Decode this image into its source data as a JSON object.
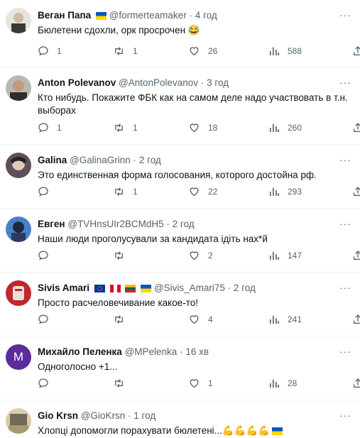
{
  "tweets": [
    {
      "name": "Веган Папа",
      "handle": "@formerteamaker",
      "time": "4 год",
      "text": "Бюлетени сдохли, орк просрочен 😂",
      "flags": [
        "ua"
      ],
      "stats": {
        "replies": "1",
        "retweets": "1",
        "likes": "26",
        "views": "588"
      },
      "avatar_color": "#d9d2c8"
    },
    {
      "name": "Anton Polevanov",
      "handle": "@AntonPolevanov",
      "time": "3 год",
      "text": "Кто нибудь. Покажите ФБК как на самом деле надо участвовать в т.н. выборах",
      "flags": [],
      "stats": {
        "replies": "1",
        "retweets": "1",
        "likes": "18",
        "views": "260"
      },
      "avatar_color": "#8e8f86"
    },
    {
      "name": "Galina",
      "handle": "@GalinaGrinn",
      "time": "2 год",
      "text": "Это единственная форма голосования, которого достойна рф.",
      "flags": [],
      "stats": {
        "replies": "",
        "retweets": "1",
        "likes": "22",
        "views": "293"
      },
      "avatar_color": "#6b5a63"
    },
    {
      "name": "Евген",
      "handle": "@TVHnsUIr2BCMdH5",
      "time": "2 год",
      "text": "Наши люди проголусували за кандидата ідіть нах*й",
      "flags": [],
      "stats": {
        "replies": "",
        "retweets": "",
        "likes": "2",
        "views": "147"
      },
      "avatar_color": "#3c6db3"
    },
    {
      "name": "Sivis Amari",
      "handle": "@Sivis_Amari75",
      "time": "2 год",
      "text": "Просто расчеловечивание какое-то!",
      "flags": [
        "eu",
        "pe",
        "lt",
        "ua"
      ],
      "stats": {
        "replies": "",
        "retweets": "",
        "likes": "4",
        "views": "241"
      },
      "avatar_color": "#c0262c"
    },
    {
      "name": "Михайло Пеленка",
      "handle": "@MPelenka",
      "time": "16 хв",
      "text": "Одноголосно +1...",
      "flags": [],
      "stats": {
        "replies": "",
        "retweets": "",
        "likes": "1",
        "views": "28"
      },
      "avatar_color": "#5c2a9d",
      "avatar_letter": "M"
    },
    {
      "name": "Gio Krsn",
      "handle": "@GioKrsn",
      "time": "1 год",
      "text": "Хлопці допомогли порахувати бюлетені...💪💪💪💪",
      "flags": [],
      "text_flag": "ua",
      "stats": {
        "replies": "",
        "retweets": "",
        "likes": "",
        "views": ""
      },
      "avatar_color": "#c9b98f"
    }
  ],
  "separator": "·",
  "colors": {
    "muted": "#536471",
    "text": "#0f1419",
    "ukraine_blue": "#0057b7",
    "ukraine_yellow": "#ffd700"
  }
}
